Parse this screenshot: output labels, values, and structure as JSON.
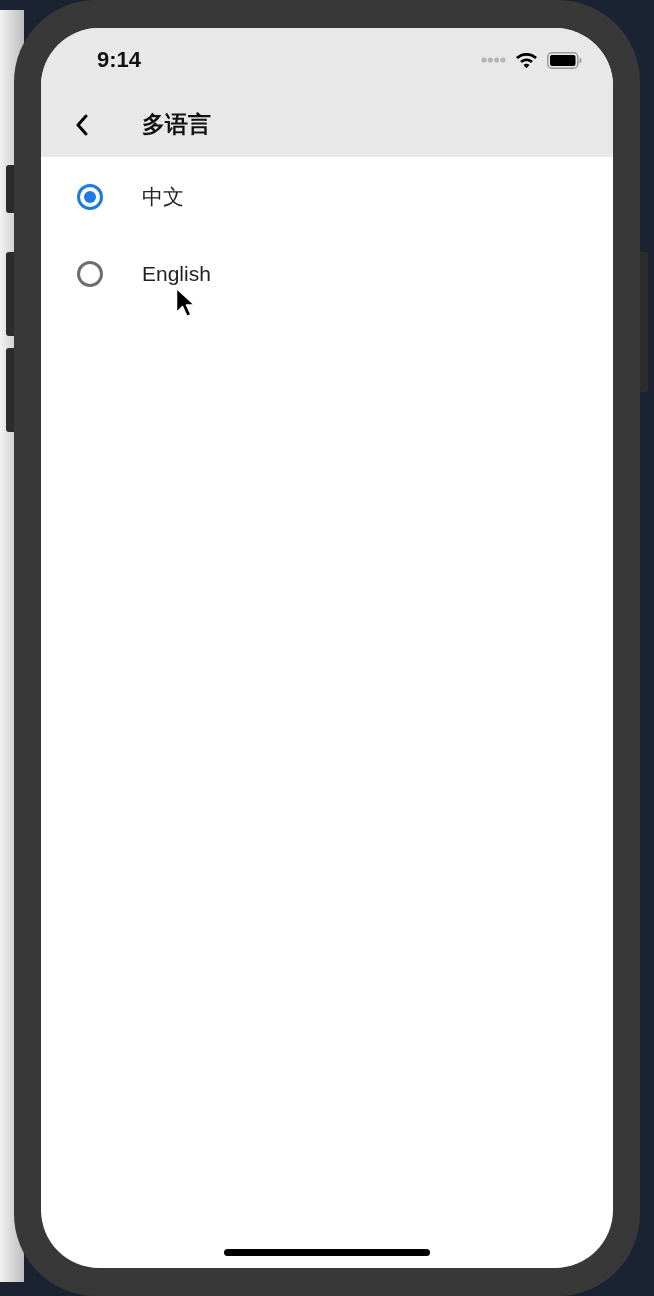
{
  "status_bar": {
    "time": "9:14"
  },
  "nav_bar": {
    "title": "多语言"
  },
  "languages": [
    {
      "label": "中文",
      "selected": true
    },
    {
      "label": "English",
      "selected": false
    }
  ]
}
